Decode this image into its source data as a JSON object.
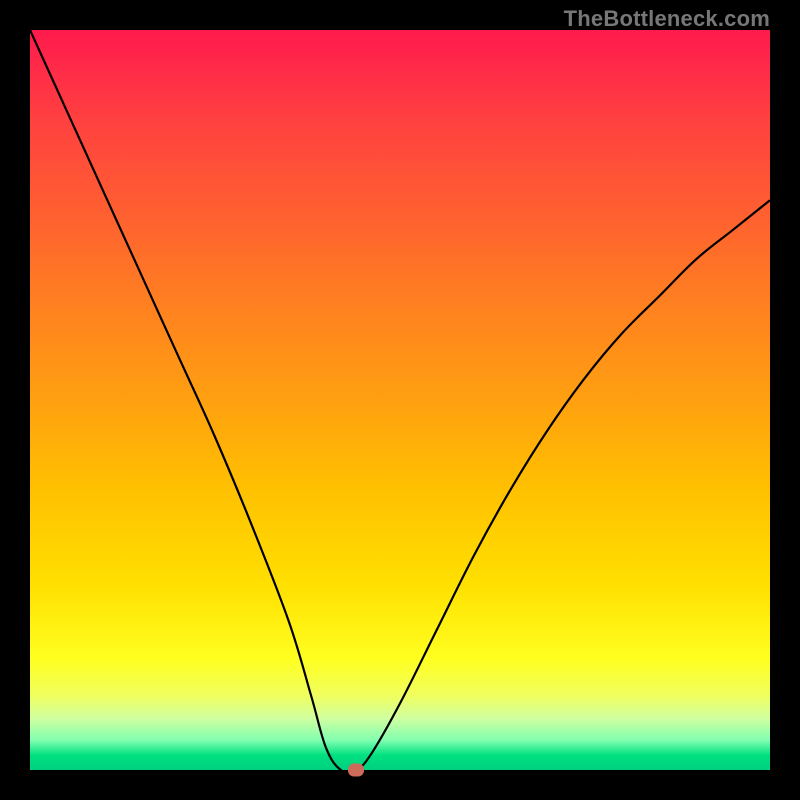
{
  "watermark": "TheBottleneck.com",
  "colors": {
    "frame": "#000000",
    "curve": "#000000",
    "marker": "#cc6b5a",
    "watermark": "#777777"
  },
  "chart_data": {
    "type": "line",
    "title": "",
    "xlabel": "",
    "ylabel": "",
    "xlim": [
      0,
      100
    ],
    "ylim": [
      0,
      100
    ],
    "x": [
      0,
      5,
      10,
      15,
      20,
      25,
      30,
      35,
      38,
      40,
      42,
      44,
      46,
      50,
      55,
      60,
      65,
      70,
      75,
      80,
      85,
      90,
      95,
      100
    ],
    "values": [
      100,
      89,
      78,
      67,
      56,
      45,
      33,
      20,
      10,
      3,
      0,
      0,
      2,
      9,
      19,
      29,
      38,
      46,
      53,
      59,
      64,
      69,
      73,
      77
    ],
    "marker": {
      "x": 44,
      "y": 0
    }
  }
}
